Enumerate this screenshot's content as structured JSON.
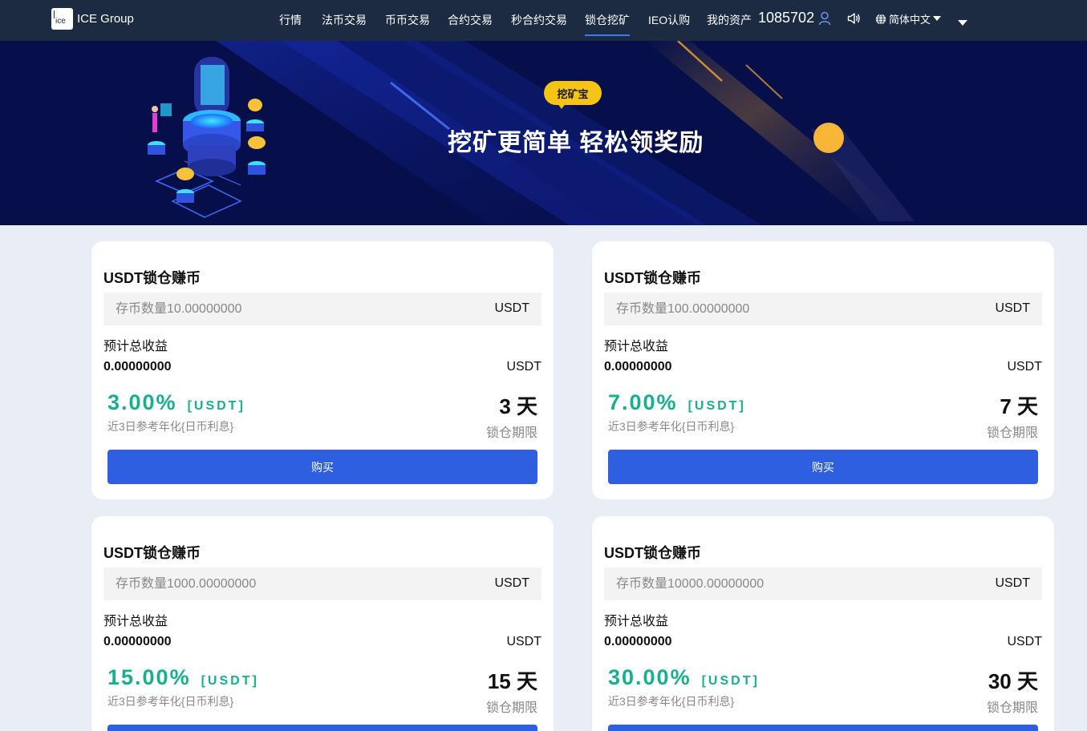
{
  "header": {
    "logo_mark": "ice",
    "logo_text": "ICE Group",
    "nav": [
      {
        "label": "行情",
        "active": false
      },
      {
        "label": "法币交易",
        "active": false
      },
      {
        "label": "币币交易",
        "active": false
      },
      {
        "label": "合约交易",
        "active": false
      },
      {
        "label": "秒合约交易",
        "active": false
      },
      {
        "label": "锁仓挖矿",
        "active": true
      },
      {
        "label": "IEO认购",
        "active": false
      },
      {
        "label": "我的资产",
        "active": false
      }
    ],
    "balance": "1085702",
    "language": "简体中文",
    "icons": [
      "user-icon",
      "speaker-icon",
      "globe-icon",
      "caret-down-icon",
      "menu-caret-icon"
    ]
  },
  "banner": {
    "badge": "挖矿宝",
    "slogan": "挖矿更简单 轻松领奖励"
  },
  "cards": [
    {
      "title": "USDT锁仓赚币",
      "amount_placeholder": "存币数量10.00000000",
      "amount_unit": "USDT",
      "est_label": "预计总收益",
      "est_value": "0.00000000",
      "est_unit": "USDT",
      "rate": "3.00%",
      "rate_unit": "[USDT]",
      "rate_desc": "近3日参考年化{日币利息}",
      "days": "3 天",
      "days_desc": "锁仓期限",
      "buy_label": "购买"
    },
    {
      "title": "USDT锁仓赚币",
      "amount_placeholder": "存币数量100.00000000",
      "amount_unit": "USDT",
      "est_label": "预计总收益",
      "est_value": "0.00000000",
      "est_unit": "USDT",
      "rate": "7.00%",
      "rate_unit": "[USDT]",
      "rate_desc": "近3日参考年化{日币利息}",
      "days": "7 天",
      "days_desc": "锁仓期限",
      "buy_label": "购买"
    },
    {
      "title": "USDT锁仓赚币",
      "amount_placeholder": "存币数量1000.00000000",
      "amount_unit": "USDT",
      "est_label": "预计总收益",
      "est_value": "0.00000000",
      "est_unit": "USDT",
      "rate": "15.00%",
      "rate_unit": "[USDT]",
      "rate_desc": "近3日参考年化{日币利息}",
      "days": "15 天",
      "days_desc": "锁仓期限",
      "buy_label": ""
    },
    {
      "title": "USDT锁仓赚币",
      "amount_placeholder": "存币数量10000.00000000",
      "amount_unit": "USDT",
      "est_label": "预计总收益",
      "est_value": "0.00000000",
      "est_unit": "USDT",
      "rate": "30.00%",
      "rate_unit": "[USDT]",
      "rate_desc": "近3日参考年化{日币利息}",
      "days": "30 天",
      "days_desc": "锁仓期限",
      "buy_label": ""
    }
  ],
  "colors": {
    "header_bg": "#1c2a42",
    "banner_bg": "#060f4a",
    "page_bg": "#e8edf6",
    "accent_green": "#14b08f",
    "button_blue": "#2e5fe0",
    "badge_yellow": "#f5c414",
    "active_underline": "#3b7cf4"
  }
}
